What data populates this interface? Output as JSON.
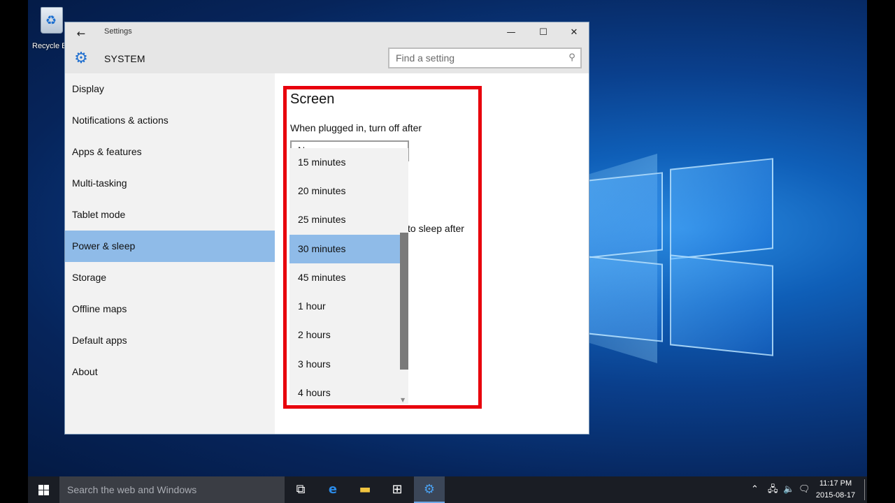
{
  "desktop": {
    "recycle_bin_label": "Recycle Bin",
    "accent": "#0a3f8c"
  },
  "window": {
    "title": "Settings",
    "section": "SYSTEM",
    "search_placeholder": "Find a setting",
    "controls": {
      "back": "←",
      "minimize": "—",
      "maximize": "☐",
      "close": "✕"
    }
  },
  "sidebar": {
    "items": [
      {
        "label": "Display"
      },
      {
        "label": "Notifications & actions"
      },
      {
        "label": "Apps & features"
      },
      {
        "label": "Multi-tasking"
      },
      {
        "label": "Tablet mode"
      },
      {
        "label": "Power & sleep",
        "active": true
      },
      {
        "label": "Storage"
      },
      {
        "label": "Offline maps"
      },
      {
        "label": "Default apps"
      },
      {
        "label": "About"
      }
    ],
    "selected_color": "#8fbbe8"
  },
  "content": {
    "heading": "Screen",
    "plugged_label": "When plugged in, turn off after",
    "plugged_value": "Never",
    "sleep_label_partial": "to sleep after"
  },
  "dropdown": {
    "options": [
      "15 minutes",
      "20 minutes",
      "25 minutes",
      "30 minutes",
      "45 minutes",
      "1 hour",
      "2 hours",
      "3 hours",
      "4 hours"
    ],
    "selected": "30 minutes"
  },
  "annotation": {
    "highlight_color": "#e8000c"
  },
  "taskbar": {
    "search_placeholder": "Search the web and Windows",
    "time": "11:17 PM",
    "date": "2015-08-17"
  }
}
